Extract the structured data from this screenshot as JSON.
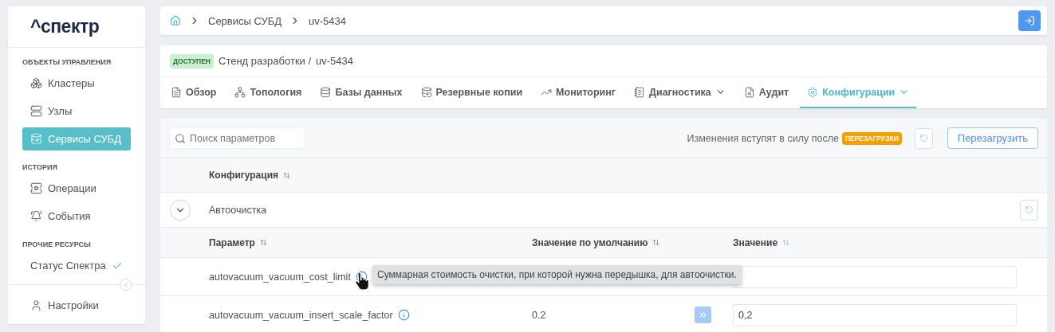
{
  "sidebar": {
    "logo": "^спектр",
    "sections": [
      {
        "title": "ОБЪЕКТЫ УПРАВЛЕНИЯ",
        "items": [
          {
            "label": "Кластеры",
            "selected": false
          },
          {
            "label": "Узлы",
            "selected": false
          },
          {
            "label": "Сервисы СУБД",
            "selected": true
          }
        ]
      },
      {
        "title": "ИСТОРИЯ",
        "items": [
          {
            "label": "Операции",
            "selected": false
          },
          {
            "label": "События",
            "selected": false
          }
        ]
      },
      {
        "title": "ПРОЧИЕ РЕСУРСЫ",
        "items": [
          {
            "label": "Статус Спектра",
            "selected": false
          }
        ]
      }
    ],
    "footer_item": "Настройки"
  },
  "breadcrumbs": [
    "Сервисы СУБД",
    "uv-5434"
  ],
  "header": {
    "status": "ДОСТУПЕН",
    "path": "Стенд разработки /",
    "name": "uv-5434"
  },
  "tabs": [
    {
      "label": "Обзор",
      "selected": false,
      "dropdown": false
    },
    {
      "label": "Топология",
      "selected": false,
      "dropdown": false
    },
    {
      "label": "Базы данных",
      "selected": false,
      "dropdown": false
    },
    {
      "label": "Резервные копии",
      "selected": false,
      "dropdown": false
    },
    {
      "label": "Мониторинг",
      "selected": false,
      "dropdown": false
    },
    {
      "label": "Диагностика",
      "selected": false,
      "dropdown": true
    },
    {
      "label": "Аудит",
      "selected": false,
      "dropdown": false
    },
    {
      "label": "Конфигурации",
      "selected": true,
      "dropdown": true
    }
  ],
  "toolbar": {
    "search_placeholder": "Поиск параметров",
    "notice": "Изменения вступят в силу после",
    "notice_badge": "ПЕРЕЗАГРУЗКИ",
    "reload_button": "Перезагрузить"
  },
  "table": {
    "column": {
      "label": "Конфигурация",
      "sorted": false
    },
    "group": {
      "label": "Автоочистка",
      "expanded": true
    },
    "param_columns": [
      {
        "label": "Параметр",
        "sorted": false
      },
      {
        "label": "Значение по умолчанию",
        "sorted": false
      },
      {
        "label": "Значение",
        "sorted": true
      }
    ],
    "rows": [
      {
        "name": "autovacuum_vacuum_cost_limit",
        "tooltip": "Суммарная стоимость очистки, при которой нужна передышка, для автоочистки."
      },
      {
        "name": "autovacuum_vacuum_insert_scale_factor",
        "default": "0.2",
        "value": "0,2"
      }
    ]
  }
}
